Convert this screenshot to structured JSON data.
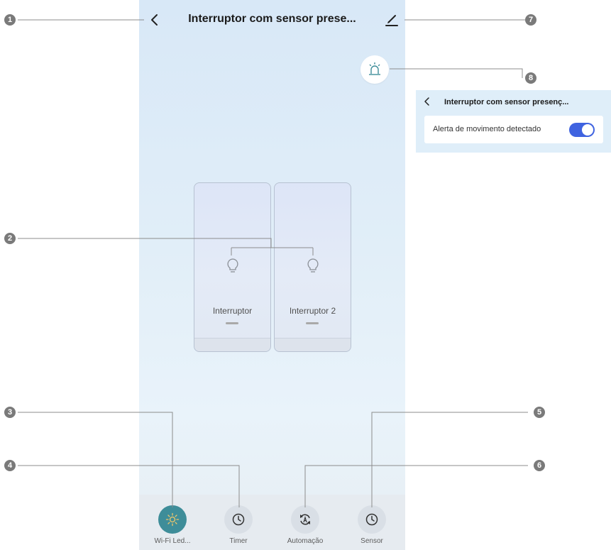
{
  "header": {
    "title": "Interruptor com sensor prese...",
    "back_icon": "chevron-left-icon",
    "edit_icon": "pencil-icon",
    "alarm_icon": "siren-icon"
  },
  "switches": [
    {
      "label": "Interruptor",
      "icon": "bulb-icon"
    },
    {
      "label": "Interruptor 2",
      "icon": "bulb-icon"
    }
  ],
  "tabs": [
    {
      "label": "Wi-Fi Led...",
      "icon": "sun-icon",
      "active": true
    },
    {
      "label": "Timer",
      "icon": "clock-icon",
      "active": false
    },
    {
      "label": "Automação",
      "icon": "automation-icon",
      "active": false
    },
    {
      "label": "Sensor",
      "icon": "clock-icon",
      "active": false
    }
  ],
  "inset": {
    "title": "Interruptor com sensor presenç...",
    "row_label": "Alerta de movimento detectado",
    "toggle_on": true
  },
  "callouts": [
    "1",
    "2",
    "3",
    "4",
    "5",
    "6",
    "7",
    "8"
  ],
  "colors": {
    "accent_toggle": "#3f63e0",
    "active_tab": "#3e8d99",
    "callout": "#7a7a7a"
  }
}
